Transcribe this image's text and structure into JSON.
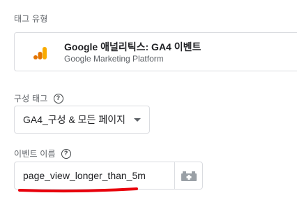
{
  "tag_type": {
    "label": "태그 유형",
    "title": "Google 애널리틱스: GA4 이벤트",
    "subtitle": "Google Marketing Platform",
    "logo_icon": "google-analytics-icon",
    "logo_colors": [
      "#f9ab00",
      "#e37400"
    ]
  },
  "config_tag": {
    "label": "구성 태그",
    "selected_value": "GA4_구성 & 모든 페이지",
    "help_icon": "help-circle-icon"
  },
  "event_name": {
    "label": "이벤트 이름",
    "value": "page_view_longer_than_5m",
    "help_icon": "help-circle-icon",
    "variable_button_icon": "variable-brick-icon"
  },
  "annotation": {
    "underline_color": "#e8000b"
  }
}
